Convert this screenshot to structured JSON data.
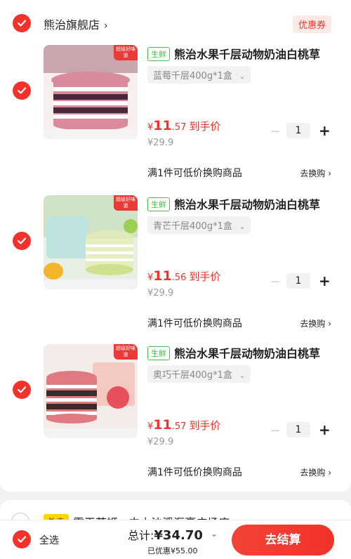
{
  "store": {
    "name": "熊治旗舰店",
    "chevron": "›",
    "coupon_label": "优惠券"
  },
  "items": [
    {
      "tag": "生鲜",
      "title": "熊治水果千层动物奶油白桃草",
      "spec": "蓝莓千层400g*1盒",
      "price_symbol": "¥",
      "price_int": "11",
      "price_dec": ".57",
      "price_label": "到手价",
      "original_price": "¥29.9",
      "quantity": "1",
      "promo": "满1件可低价换购商品",
      "promo_link": "去换购",
      "thumb_badge": "超级好味道",
      "thumb_color": "#d9a0ad",
      "thumb_label": "蓝莓千层"
    },
    {
      "tag": "生鲜",
      "title": "熊治水果千层动物奶油白桃草",
      "spec": "青芒千层400g*1盒",
      "price_symbol": "¥",
      "price_int": "11",
      "price_dec": ".56",
      "price_label": "到手价",
      "original_price": "¥29.9",
      "quantity": "1",
      "promo": "满1件可低价换购商品",
      "promo_link": "去换购",
      "thumb_badge": "超级好味道",
      "thumb_color": "#b9d98a",
      "thumb_label": "熊治青芒千层"
    },
    {
      "tag": "生鲜",
      "title": "熊治水果千层动物奶油白桃草",
      "spec": "奥巧千层400g*1盒",
      "price_symbol": "¥",
      "price_int": "11",
      "price_dec": ".57",
      "price_label": "到手价",
      "original_price": "¥29.9",
      "quantity": "1",
      "promo": "满1件可低价换购商品",
      "promo_link": "去换购",
      "thumb_badge": "超级好味道",
      "thumb_color": "#e8b1a8",
      "thumb_label": "熊治奥巧千层"
    }
  ],
  "next_store": {
    "tag": "外卖",
    "name": "霸王茶姬 · 中山沙溪汇豪广场店 ›"
  },
  "footer": {
    "select_all": "全选",
    "total_label": "总计:",
    "total_amount": "¥34.70",
    "saved": "已优惠¥55.00",
    "checkout": "去结算"
  },
  "colors": {
    "accent": "#f2322b",
    "fresh_tag": "#4bbf4b"
  },
  "icons": {
    "check": "check-icon",
    "chevron": "chevron-down-icon"
  }
}
